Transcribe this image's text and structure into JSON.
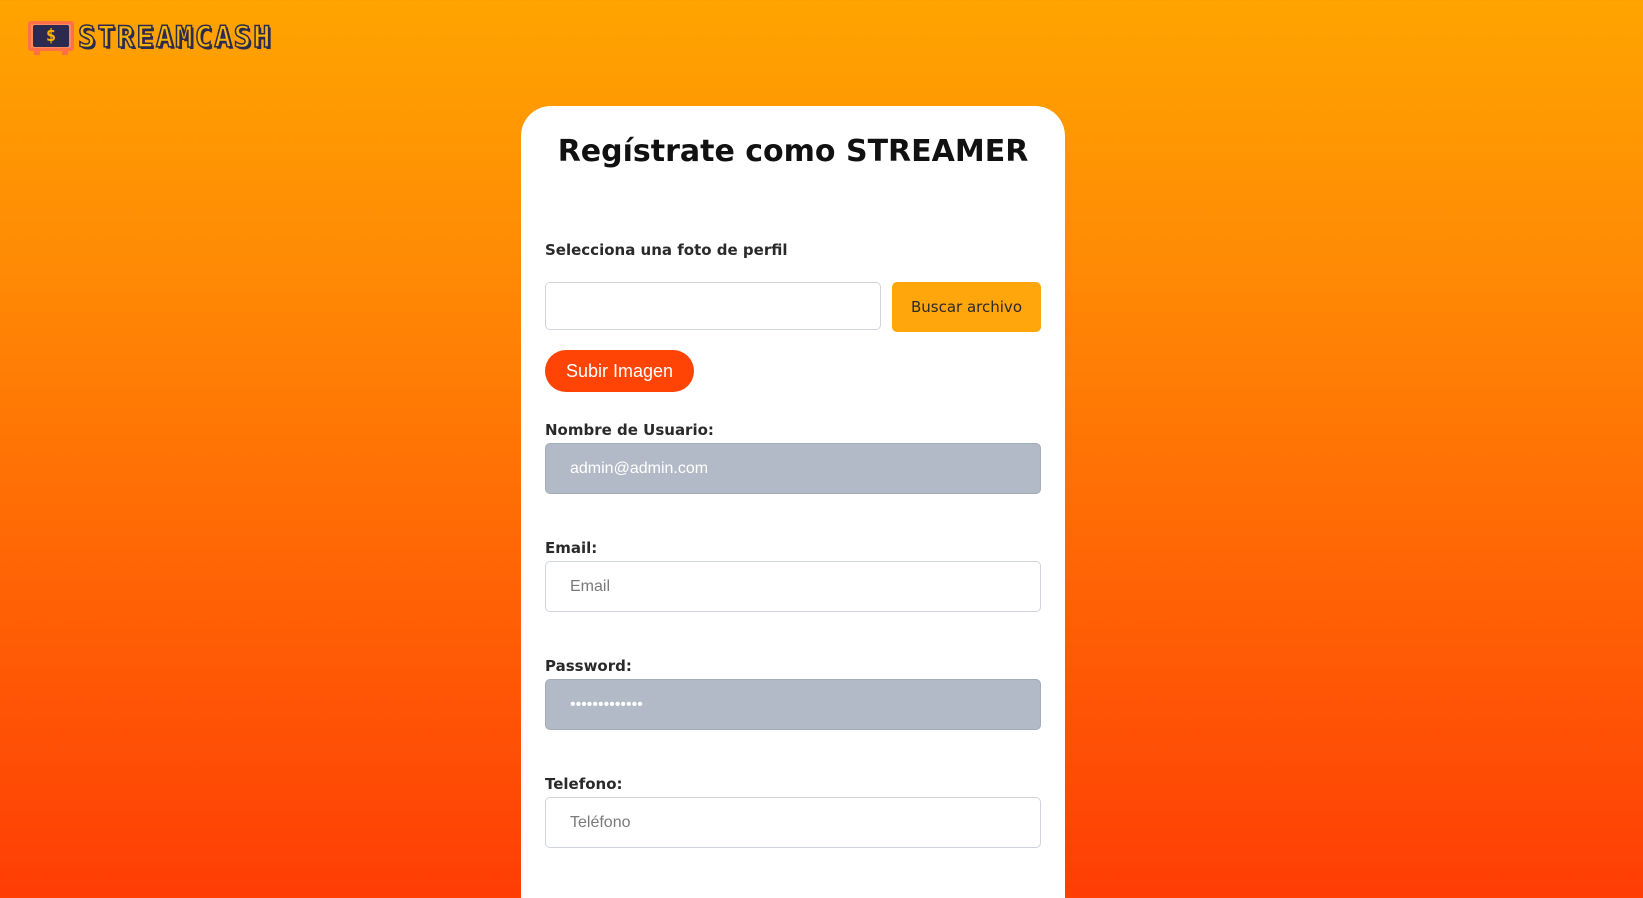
{
  "brand": {
    "logo_symbol": "$",
    "name": "STREAMCASH"
  },
  "form": {
    "title": "Regístrate como STREAMER",
    "profile_photo_label": "Selecciona una foto de perfil",
    "browse_button": "Buscar archivo",
    "upload_button": "Subir Imagen",
    "username": {
      "label": "Nombre de Usuario:",
      "value": "admin@admin.com"
    },
    "email": {
      "label": "Email:",
      "placeholder": "Email"
    },
    "password": {
      "label": "Password:",
      "value": "•••••••••••••"
    },
    "phone": {
      "label": "Telefono:",
      "placeholder": "Teléfono"
    }
  },
  "colors": {
    "background_top": "#ffa400",
    "background_bottom": "#ff3d05",
    "browse_button": "#ffa60c",
    "upload_button": "#ff4406",
    "autofill_field": "#b3bac7"
  }
}
